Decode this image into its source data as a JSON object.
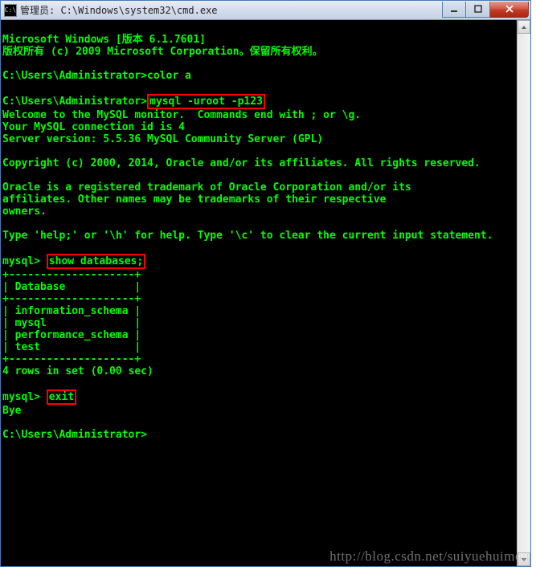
{
  "window": {
    "title": "管理员: C:\\Windows\\system32\\cmd.exe",
    "icon_label": "cmd-icon",
    "controls": {
      "minimize_label": "minimize",
      "maximize_label": "maximize",
      "close_label": "close"
    }
  },
  "terminal": {
    "l1": "Microsoft Windows [版本 6.1.7601]",
    "l2": "版权所有 (c) 2009 Microsoft Corporation。保留所有权利。",
    "blank": "",
    "l3p": "C:\\Users\\Administrator>",
    "l3c": "color a",
    "l4p": "C:\\Users\\Administrator>",
    "l4c": "mysql -uroot -p123",
    "l5": "Welcome to the MySQL monitor.  Commands end with ; or \\g.",
    "l6": "Your MySQL connection id is 4",
    "l7": "Server version: 5.5.36 MySQL Community Server (GPL)",
    "l8": "Copyright (c) 2000, 2014, Oracle and/or its affiliates. All rights reserved.",
    "l9": "Oracle is a registered trademark of Oracle Corporation and/or its",
    "l10": "affiliates. Other names may be trademarks of their respective",
    "l11": "owners.",
    "l12": "Type 'help;' or '\\h' for help. Type '\\c' to clear the current input statement.",
    "l13p": "mysql> ",
    "l13c": "show databases;",
    "t1": "+--------------------+",
    "t2": "| Database           |",
    "t3": "+--------------------+",
    "t4": "| information_schema |",
    "t5": "| mysql              |",
    "t6": "| performance_schema |",
    "t7": "| test               |",
    "t8": "+--------------------+",
    "l14": "4 rows in set (0.00 sec)",
    "l15p": "mysql> ",
    "l15c": "exit",
    "l16": "Bye",
    "l17": "C:\\Users\\Administrator>"
  },
  "watermark": "http://blog.csdn.net/suiyuehuimou"
}
